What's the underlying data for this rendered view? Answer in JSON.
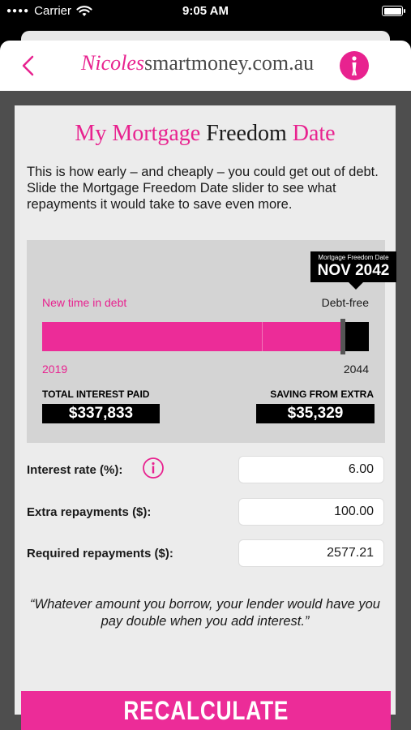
{
  "status_bar": {
    "carrier": "Carrier",
    "time": "9:05 AM"
  },
  "header": {
    "logo_name": "Nicoles",
    "logo_rest": "smartmoney.com.au"
  },
  "card": {
    "title_part1": "My Mortgage",
    "title_part2": "Freedom",
    "title_part3": "Date",
    "intro": "This is how early – and cheaply – you could get out of debt. Slide the Mortgage Freedom Date slider to see what repayments it would take to save even more."
  },
  "slider": {
    "date_caption": "Mortgage Freedom Date",
    "date_value": "NOV 2042",
    "new_time_label": "New time in debt",
    "debt_free_label": "Debt-free",
    "start_year": "2019",
    "end_year": "2044",
    "freedom_fraction": 0.92
  },
  "stats": {
    "interest_label": "TOTAL INTEREST PAID",
    "interest_value": "$337,833",
    "saving_label": "SAVING FROM EXTRA",
    "saving_value": "$35,329"
  },
  "fields": {
    "interest_rate_label": "Interest rate (%):",
    "interest_rate_value": "6.00",
    "extra_label": "Extra repayments ($):",
    "extra_value": "100.00",
    "required_label": "Required repayments ($):",
    "required_value": "2577.21"
  },
  "quote": "“Whatever amount you borrow, your lender would have you pay double when you add interest.”",
  "button": {
    "recalculate": "RECALCULATE"
  },
  "colors": {
    "brand_pink": "#e8228f",
    "bar_pink": "#ec2c98",
    "dark_panel": "#4e4e4e"
  },
  "icons": [
    "wifi-icon",
    "battery-icon",
    "back-chevron-icon",
    "logo-badge-icon",
    "info-icon"
  ]
}
